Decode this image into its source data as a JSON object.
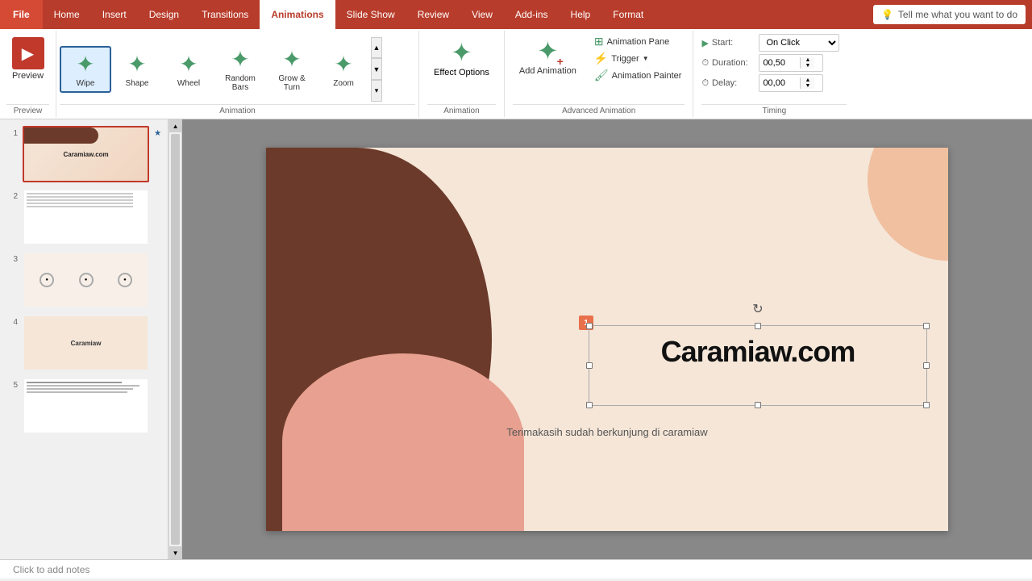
{
  "tabs": {
    "file": "File",
    "home": "Home",
    "insert": "Insert",
    "design": "Design",
    "transitions": "Transitions",
    "animations": "Animations",
    "slideshow": "Slide Show",
    "review": "Review",
    "view": "View",
    "addins": "Add-ins",
    "help": "Help",
    "format": "Format"
  },
  "tell_me": "Tell me what you want to do",
  "ribbon": {
    "preview_label": "Preview",
    "animation_label": "Animation",
    "effect_options_label": "Effect Options",
    "advanced_animation_label": "Advanced Animation",
    "timing_label": "Timing",
    "animations": [
      {
        "id": "wipe",
        "label": "Wipe",
        "selected": true
      },
      {
        "id": "shape",
        "label": "Shape"
      },
      {
        "id": "wheel",
        "label": "Wheel"
      },
      {
        "id": "random_bars",
        "label": "Random Bars"
      },
      {
        "id": "grow_turn",
        "label": "Grow & Turn"
      },
      {
        "id": "zoom",
        "label": "Zoom"
      }
    ],
    "effect_options": "Effect Options",
    "add_animation": "Add Animation",
    "animation_pane": "Animation Pane",
    "trigger": "Trigger",
    "animation_painter": "Animation Painter",
    "start_label": "Start:",
    "start_value": "On Click",
    "duration_label": "Duration:",
    "duration_value": "00,50",
    "delay_label": "Delay:",
    "delay_value": "00,00"
  },
  "slides": [
    {
      "num": "1",
      "active": true,
      "has_star": true
    },
    {
      "num": "2",
      "active": false,
      "has_star": false
    },
    {
      "num": "3",
      "active": false,
      "has_star": false
    },
    {
      "num": "4",
      "active": false,
      "has_star": false
    },
    {
      "num": "5",
      "active": false,
      "has_star": false
    }
  ],
  "slide": {
    "title": "Caramiaw.com",
    "subtitle": "Terimakasih sudah berkunjung di caramiaw",
    "anim_badge": "1"
  },
  "notes": {
    "placeholder": "Click to add notes"
  }
}
